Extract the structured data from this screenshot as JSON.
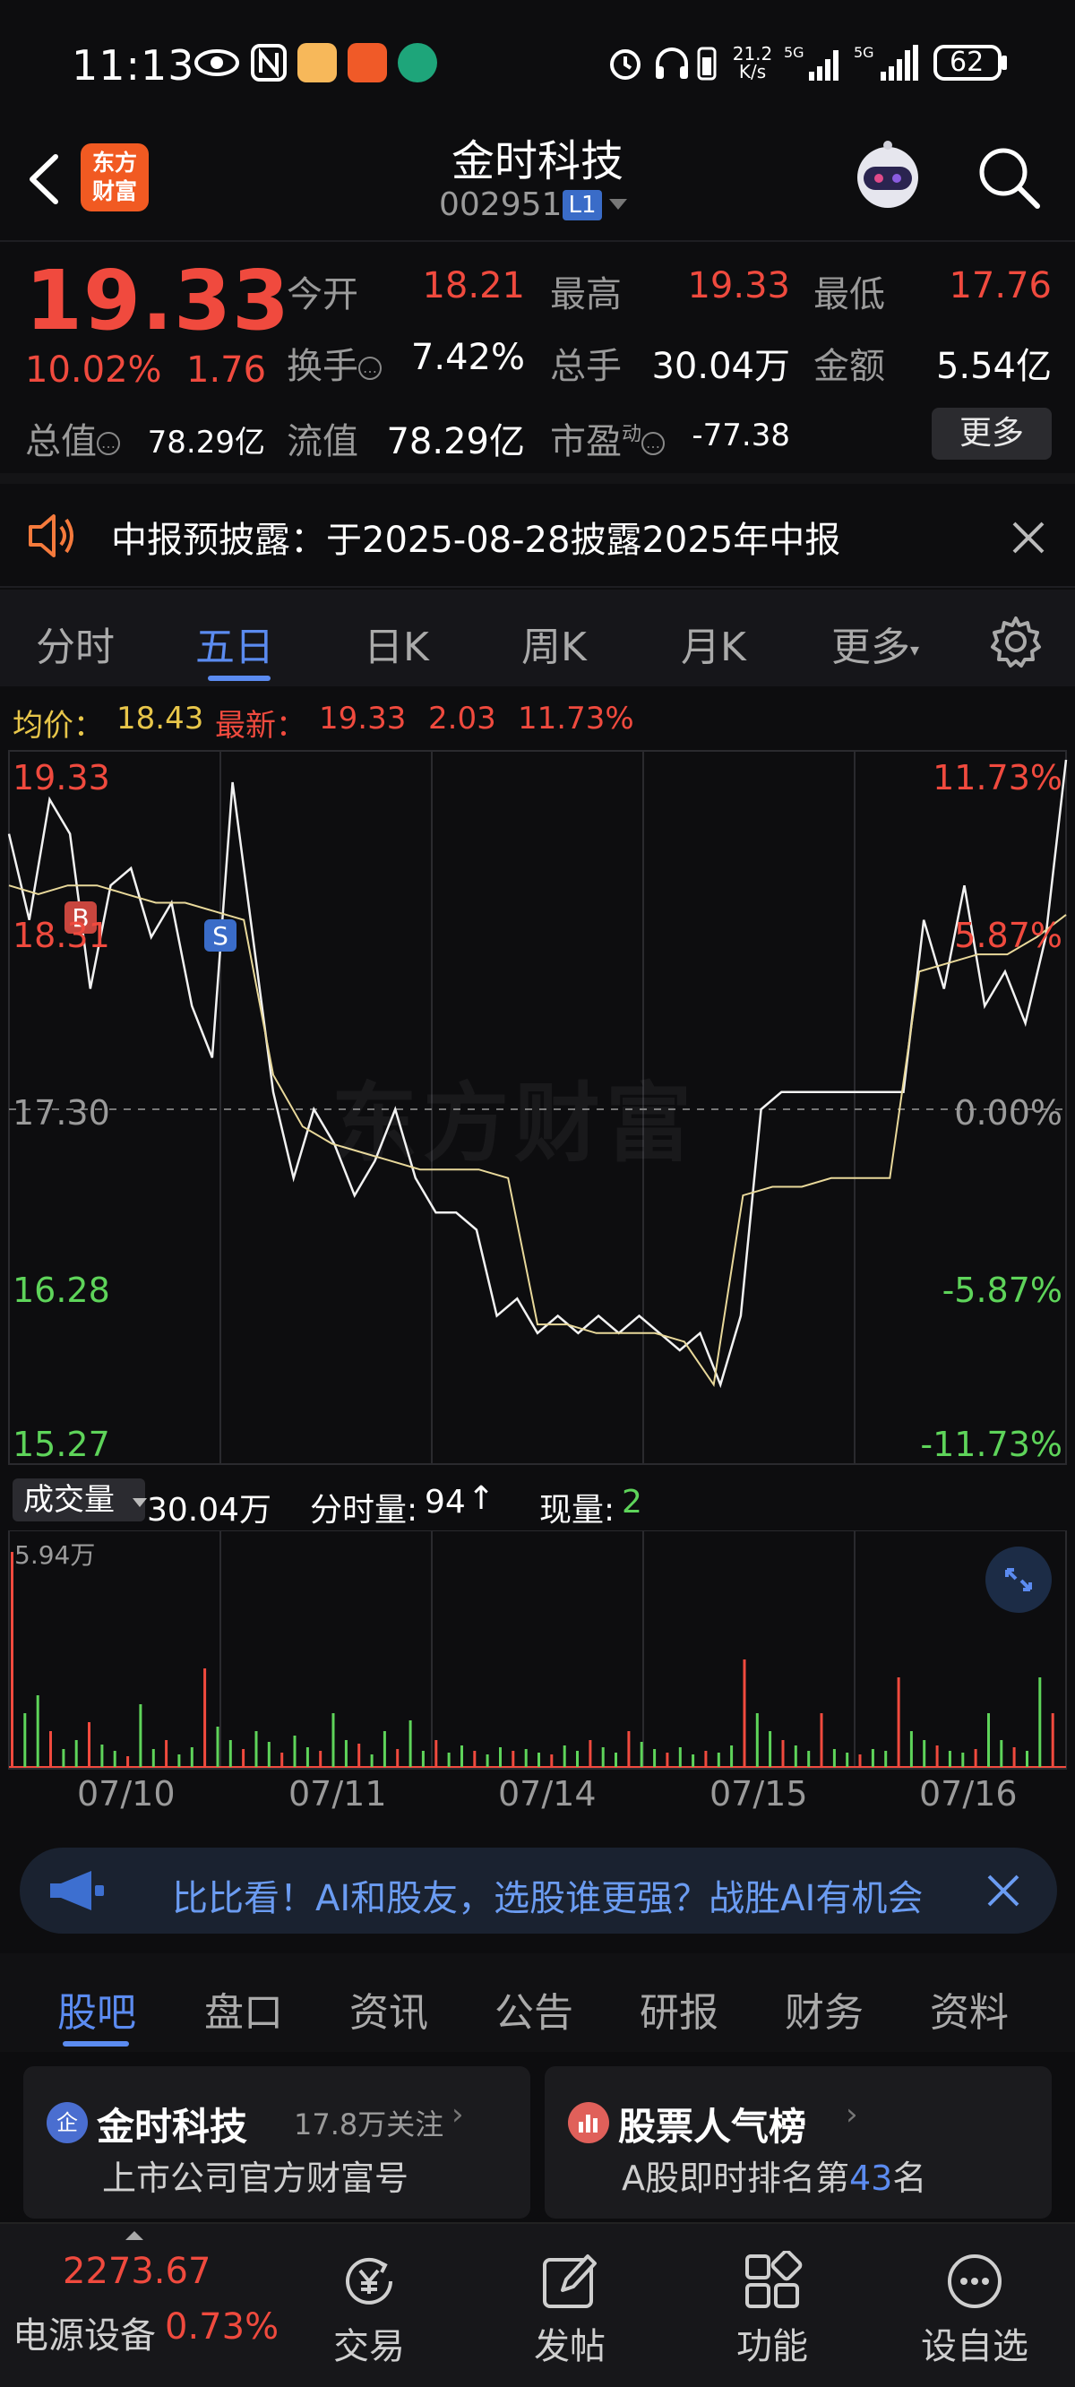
{
  "status_bar": {
    "time": "11:13",
    "net_speed": "21.2 K/s",
    "battery": "62",
    "signal_labels": [
      "5G",
      "5G"
    ]
  },
  "header": {
    "logo_text": [
      "东方",
      "财富"
    ],
    "stock_name": "金时科技",
    "stock_code": "002951",
    "level_badge": "L1"
  },
  "quote": {
    "price": "19.33",
    "change_pct": "10.02%",
    "change_abs": "1.76",
    "open_label": "今开",
    "open": "18.21",
    "high_label": "最高",
    "high": "19.33",
    "low_label": "最低",
    "low": "17.76",
    "turnover_label": "换手",
    "turnover": "7.42%",
    "volume_label": "总手",
    "volume": "30.04万",
    "amount_label": "金额",
    "amount": "5.54亿",
    "mktcap_label": "总值",
    "mktcap": "78.29亿",
    "float_label": "流值",
    "float": "78.29亿",
    "pe_label": "市盈",
    "pe_sup": "动",
    "pe": "-77.38",
    "more_btn": "更多"
  },
  "notice": {
    "text": "中报预披露：于2025-08-28披露2025年中报"
  },
  "chart_tabs": {
    "items": [
      "分时",
      "五日",
      "日K",
      "周K",
      "月K",
      "更多"
    ],
    "active": 1
  },
  "avg_line": {
    "avg_label": "均价：",
    "avg_value": "18.43",
    "latest_label": "最新：",
    "latest_value": "19.33",
    "latest_change": "2.03",
    "latest_pct": "11.73%"
  },
  "chart_data": {
    "type": "line",
    "title": "",
    "watermark": "东方财富",
    "x": [
      "07/10",
      "07/11",
      "07/14",
      "07/15",
      "07/16"
    ],
    "y_left_ticks": [
      "19.33",
      "18.31",
      "17.30",
      "16.28",
      "15.27"
    ],
    "y_right_ticks": [
      "11.73%",
      "5.87%",
      "0.00%",
      "-5.87%",
      "-11.73%"
    ],
    "ylim": [
      15.27,
      19.33
    ],
    "prev_close": 17.3,
    "series": [
      {
        "values": [
          18.9,
          18.4,
          19.1,
          18.9,
          18.0,
          18.6,
          18.7,
          18.3,
          18.5,
          17.9,
          17.6,
          19.2,
          18.3,
          17.4,
          16.9,
          17.3,
          17.1,
          16.8,
          17.0,
          17.3,
          16.9,
          16.7,
          16.7,
          16.6,
          16.1,
          16.2,
          16.0,
          16.1,
          16.0,
          16.1,
          16.0,
          16.1,
          16.0,
          15.9,
          16.0,
          15.7,
          16.1,
          17.3,
          17.4,
          17.4,
          17.4,
          17.4,
          17.4,
          17.4,
          17.4,
          18.4,
          18.0,
          18.6,
          17.9,
          18.1,
          17.8,
          18.3,
          19.33
        ]
      },
      {
        "values": [
          18.6,
          18.55,
          18.6,
          18.6,
          18.55,
          18.5,
          18.5,
          18.45,
          18.4,
          17.5,
          17.2,
          17.1,
          17.05,
          17.0,
          16.95,
          16.95,
          16.95,
          16.9,
          16.05,
          16.05,
          16.0,
          16.0,
          16.0,
          15.95,
          15.7,
          16.8,
          16.85,
          16.85,
          16.9,
          16.9,
          16.9,
          18.1,
          18.15,
          18.2,
          18.2,
          18.3,
          18.43
        ]
      }
    ],
    "markers": [
      {
        "label": "B",
        "value": 18.31
      },
      {
        "label": "S",
        "value": 18.31
      }
    ]
  },
  "volume": {
    "selector_label": "成交量",
    "total": "30.04万",
    "tick_label": "分时量:",
    "tick_value": "94",
    "current_label": "现量:",
    "current_value": "2",
    "max_label": "5.94万"
  },
  "ad": {
    "text": "比比看！AI和股友，选股谁更强？战胜AI有机会"
  },
  "bottom_tabs": {
    "items": [
      "股吧",
      "盘口",
      "资讯",
      "公告",
      "研报",
      "财务",
      "资料"
    ],
    "active": 0
  },
  "cards": {
    "left": {
      "icon_text": "企",
      "title": "金时科技",
      "followers": "17.8万关注",
      "sub": "上市公司官方财富号"
    },
    "right": {
      "title": "股票人气榜",
      "sub_prefix": "A股即时排名第",
      "rank": "43",
      "sub_suffix": "名"
    }
  },
  "bottom_nav": {
    "index_value": "2273.67",
    "index_name": "电源设备",
    "index_pct": "0.73%",
    "items": [
      "交易",
      "发帖",
      "功能",
      "设自选"
    ]
  },
  "colors": {
    "up": "#f04a3e",
    "down": "#5ed45a",
    "accent": "#5b8bf0",
    "avg_line": "#e8d89a"
  }
}
